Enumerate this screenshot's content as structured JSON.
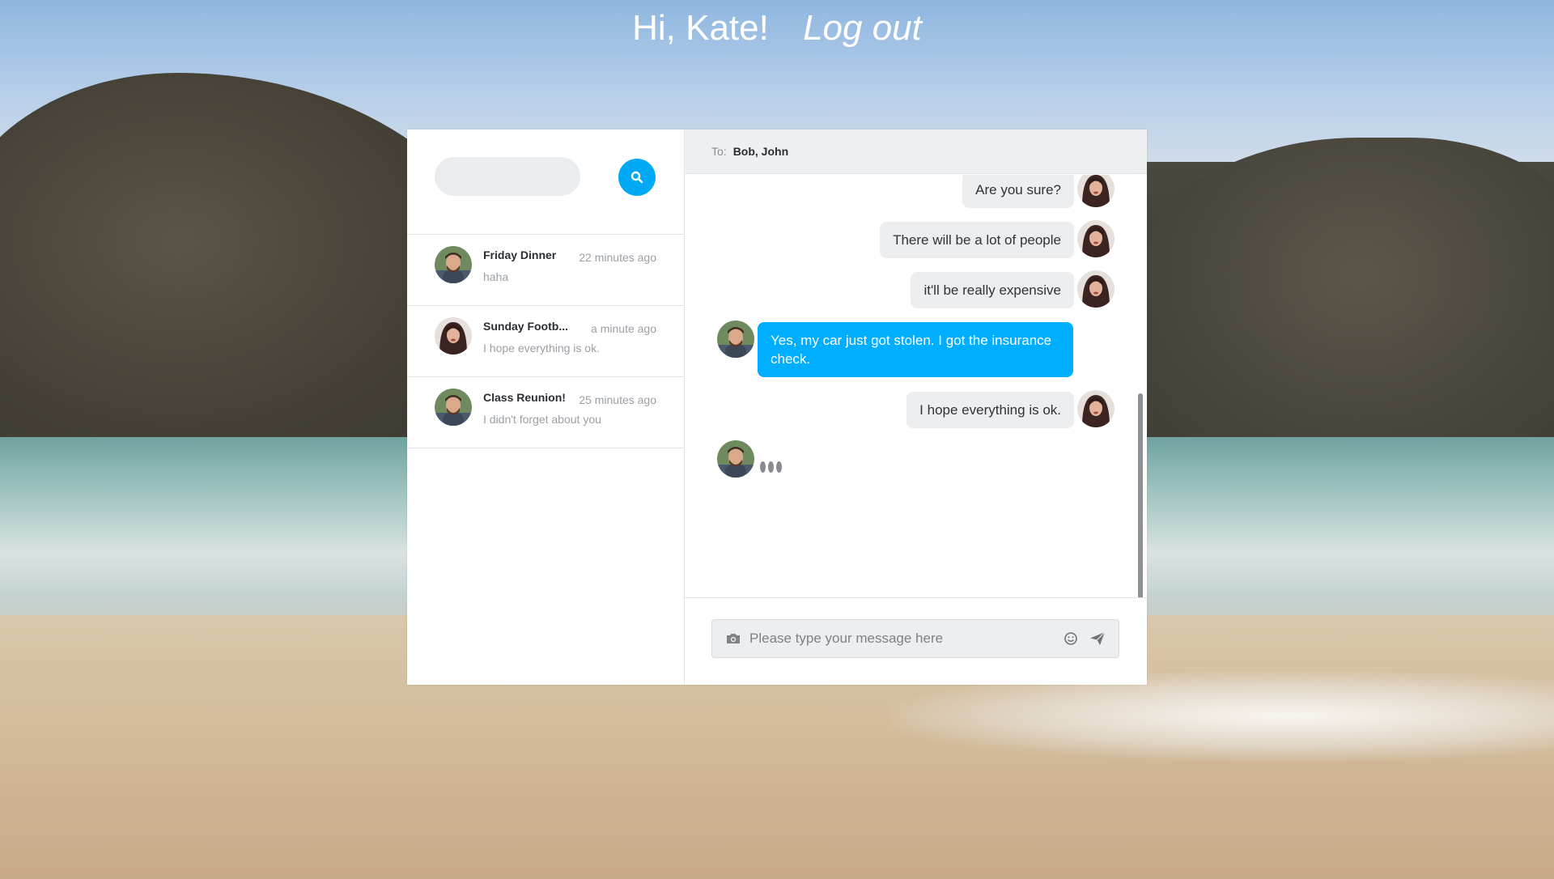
{
  "header": {
    "greeting": "Hi, Kate!",
    "logout_label": "Log out"
  },
  "search": {
    "placeholder": "",
    "button_icon": "search-icon"
  },
  "conversations": [
    {
      "name": "Friday Dinner",
      "time": "22 minutes ago",
      "preview": "haha",
      "avatar": "man-avatar"
    },
    {
      "name": "Sunday Footb...",
      "time": "a minute ago",
      "preview": "I hope everything is ok.",
      "avatar": "woman-avatar"
    },
    {
      "name": "Class Reunion!",
      "time": "25 minutes ago",
      "preview": "I didn't forget about you",
      "avatar": "man-avatar"
    }
  ],
  "chat": {
    "to_label": "To:",
    "recipients": "Bob, John",
    "messages": [
      {
        "text": "Are you sure?",
        "side": "right",
        "avatar": "woman-avatar"
      },
      {
        "text": "There will be a lot of people",
        "side": "right",
        "avatar": "woman-avatar"
      },
      {
        "text": "it'll be really expensive",
        "side": "right",
        "avatar": "woman-avatar"
      },
      {
        "text": "Yes, my car just got stolen. I got the insurance check.",
        "side": "left",
        "avatar": "man-avatar"
      },
      {
        "text": "I hope everything is ok.",
        "side": "right",
        "avatar": "woman-avatar"
      }
    ],
    "typing_indicator": "man-avatar"
  },
  "composer": {
    "placeholder": "Please type your message here",
    "icons": [
      "camera-icon",
      "smiley-icon",
      "send-icon"
    ]
  },
  "colors": {
    "accent": "#00aeff",
    "search_button": "#00a9f4",
    "bubble_in": "#eceef0"
  }
}
